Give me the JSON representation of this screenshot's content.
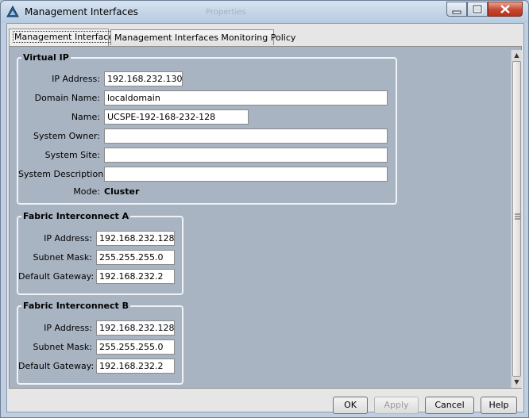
{
  "window": {
    "title": "Management Interfaces",
    "ghost_title": "Properties",
    "icons": {
      "app": "triangle-app-icon",
      "minimize": "minimize-icon",
      "maximize": "maximize-icon",
      "close": "close-icon"
    },
    "close_color": "#c6462f"
  },
  "tabs": [
    {
      "label": "Management Interfaces",
      "active": true
    },
    {
      "label": "Management Interfaces Monitoring Policy",
      "active": false
    }
  ],
  "virtual_ip": {
    "title": "Virtual IP",
    "ip_address": {
      "label": "IP Address:",
      "value": "192.168.232.130"
    },
    "domain_name": {
      "label": "Domain Name:",
      "value": "localdomain"
    },
    "name": {
      "label": "Name:",
      "value": "UCSPE-192-168-232-128"
    },
    "system_owner": {
      "label": "System Owner:",
      "value": ""
    },
    "system_site": {
      "label": "System Site:",
      "value": ""
    },
    "system_description": {
      "label": "System Description:",
      "value": ""
    },
    "mode": {
      "label": "Mode:",
      "value": "Cluster"
    }
  },
  "fabric_a": {
    "title": "Fabric Interconnect A",
    "ip_address": {
      "label": "IP Address:",
      "value": "192.168.232.128"
    },
    "subnet_mask": {
      "label": "Subnet Mask:",
      "value": "255.255.255.0"
    },
    "default_gateway": {
      "label": "Default Gateway:",
      "value": "192.168.232.2"
    }
  },
  "fabric_b": {
    "title": "Fabric Interconnect B",
    "ip_address": {
      "label": "IP Address:",
      "value": "192.168.232.128"
    },
    "subnet_mask": {
      "label": "Subnet Mask:",
      "value": "255.255.255.0"
    },
    "default_gateway": {
      "label": "Default Gateway:",
      "value": "192.168.232.2"
    }
  },
  "buttons": {
    "ok": "OK",
    "apply": "Apply",
    "cancel": "Cancel",
    "help": "Help"
  }
}
